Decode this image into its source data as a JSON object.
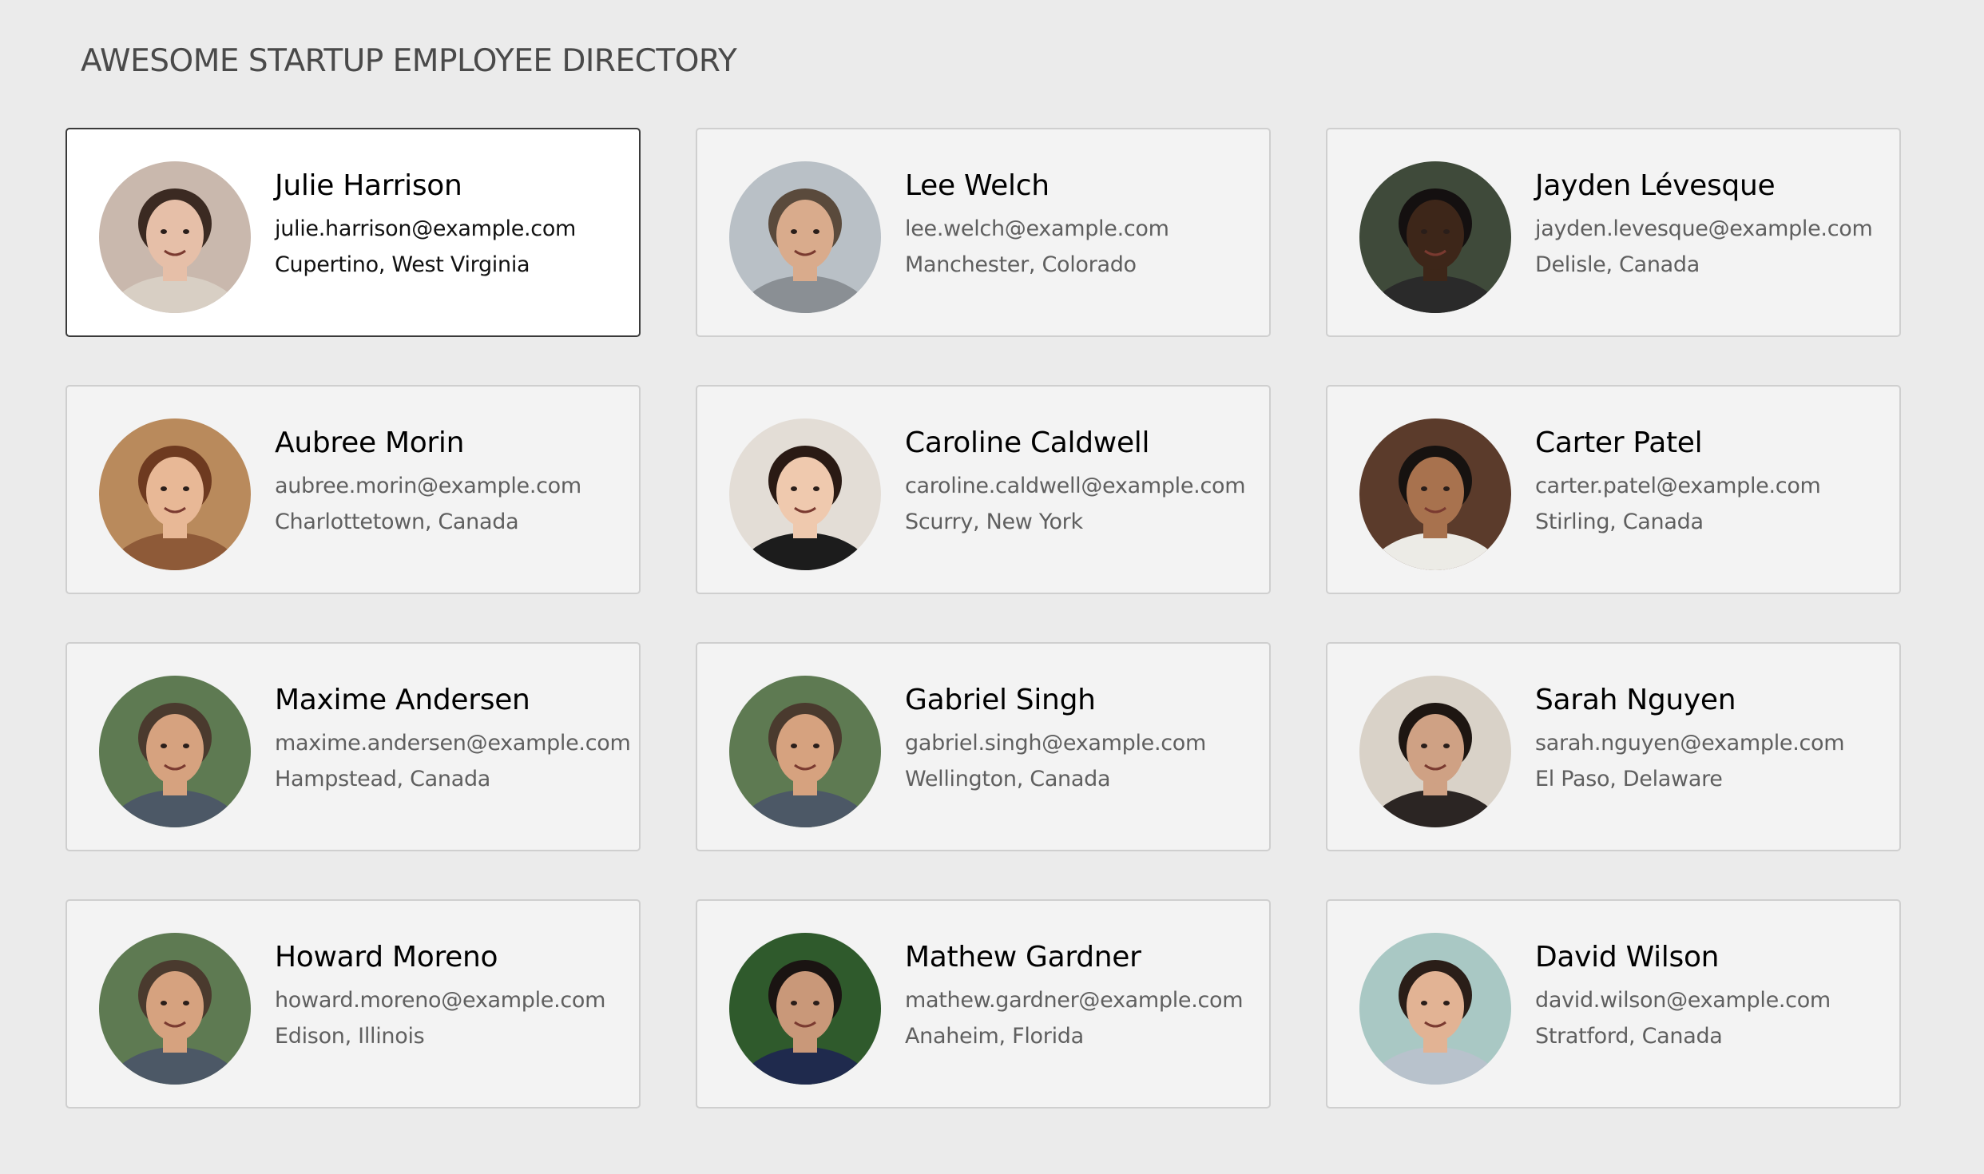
{
  "page": {
    "title": "AWESOME STARTUP EMPLOYEE DIRECTORY"
  },
  "employees": [
    {
      "name": "Julie Harrison",
      "email": "julie.harrison@example.com",
      "location": "Cupertino, West Virginia",
      "selected": true,
      "avatar": {
        "bg": "#c9b8ad",
        "skin": "#e6bfa8",
        "hair": "#3b2a22",
        "shirt": "#d8cfc4"
      }
    },
    {
      "name": "Lee Welch",
      "email": "lee.welch@example.com",
      "location": "Manchester, Colorado",
      "selected": false,
      "avatar": {
        "bg": "#b9c0c6",
        "skin": "#d9ab8c",
        "hair": "#5a4a3c",
        "shirt": "#8a8f94"
      }
    },
    {
      "name": "Jayden Lévesque",
      "email": "jayden.levesque@example.com",
      "location": "Delisle, Canada",
      "selected": false,
      "avatar": {
        "bg": "#3f4a3a",
        "skin": "#3d2619",
        "hair": "#141010",
        "shirt": "#2a2a2a"
      }
    },
    {
      "name": "Aubree Morin",
      "email": "aubree.morin@example.com",
      "location": "Charlottetown, Canada",
      "selected": false,
      "avatar": {
        "bg": "#b98a5c",
        "skin": "#e8b896",
        "hair": "#6e3a20",
        "shirt": "#8e5a38"
      }
    },
    {
      "name": "Caroline Caldwell",
      "email": "caroline.caldwell@example.com",
      "location": "Scurry, New York",
      "selected": false,
      "avatar": {
        "bg": "#e3ddd6",
        "skin": "#efc9ae",
        "hair": "#2a1a14",
        "shirt": "#1c1c1c"
      }
    },
    {
      "name": "Carter Patel",
      "email": "carter.patel@example.com",
      "location": "Stirling, Canada",
      "selected": false,
      "avatar": {
        "bg": "#5b3b2b",
        "skin": "#a8724e",
        "hair": "#161210",
        "shirt": "#ecebe6"
      }
    },
    {
      "name": "Maxime Andersen",
      "email": "maxime.andersen@example.com",
      "location": "Hampstead, Canada",
      "selected": false,
      "avatar": {
        "bg": "#5e7a52",
        "skin": "#d6a27f",
        "hair": "#4a3a2e",
        "shirt": "#4c5866"
      }
    },
    {
      "name": "Gabriel Singh",
      "email": "gabriel.singh@example.com",
      "location": "Wellington, Canada",
      "selected": false,
      "avatar": {
        "bg": "#5e7a52",
        "skin": "#d6a27f",
        "hair": "#4a3a2e",
        "shirt": "#4c5866"
      }
    },
    {
      "name": "Sarah Nguyen",
      "email": "sarah.nguyen@example.com",
      "location": "El Paso, Delaware",
      "selected": false,
      "avatar": {
        "bg": "#d9d2c8",
        "skin": "#cfa184",
        "hair": "#1e1612",
        "shirt": "#2b2523"
      }
    },
    {
      "name": "Howard Moreno",
      "email": "howard.moreno@example.com",
      "location": "Edison, Illinois",
      "selected": false,
      "avatar": {
        "bg": "#5e7a52",
        "skin": "#d6a27f",
        "hair": "#4a3a2e",
        "shirt": "#4c5866"
      }
    },
    {
      "name": "Mathew Gardner",
      "email": "mathew.gardner@example.com",
      "location": "Anaheim, Florida",
      "selected": false,
      "avatar": {
        "bg": "#2f5a2c",
        "skin": "#c99879",
        "hair": "#1a1412",
        "shirt": "#1f2a4d"
      }
    },
    {
      "name": "David Wilson",
      "email": "david.wilson@example.com",
      "location": "Stratford, Canada",
      "selected": false,
      "avatar": {
        "bg": "#a9c8c4",
        "skin": "#e2b394",
        "hair": "#2a1e18",
        "shirt": "#b8c2cc"
      }
    }
  ]
}
